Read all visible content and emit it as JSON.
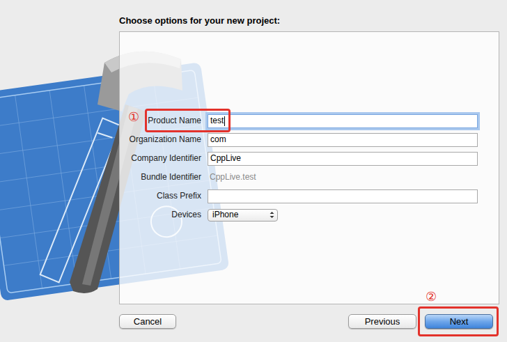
{
  "window": {
    "title": "Choose options for your new project:"
  },
  "fields": [
    {
      "kind": "field",
      "label": "Product Name",
      "value": "test",
      "focused": true
    },
    {
      "kind": "field",
      "label": "Organization Name",
      "value": "com",
      "focused": false
    },
    {
      "kind": "field",
      "label": "Company Identifier",
      "value": "CppLive",
      "focused": false
    },
    {
      "kind": "static",
      "label": "Bundle Identifier",
      "value": "CppLive.test",
      "focused": false
    },
    {
      "kind": "field",
      "label": "Class Prefix",
      "value": "",
      "focused": false
    },
    {
      "kind": "select",
      "label": "Devices",
      "value": "iPhone",
      "focused": false
    }
  ],
  "annotations": [
    {
      "label": "①"
    },
    {
      "label": "②"
    }
  ],
  "buttons": [
    {
      "label": "Cancel",
      "default": false
    },
    {
      "label": "Previous",
      "default": false
    },
    {
      "label": "Next",
      "default": true
    }
  ]
}
